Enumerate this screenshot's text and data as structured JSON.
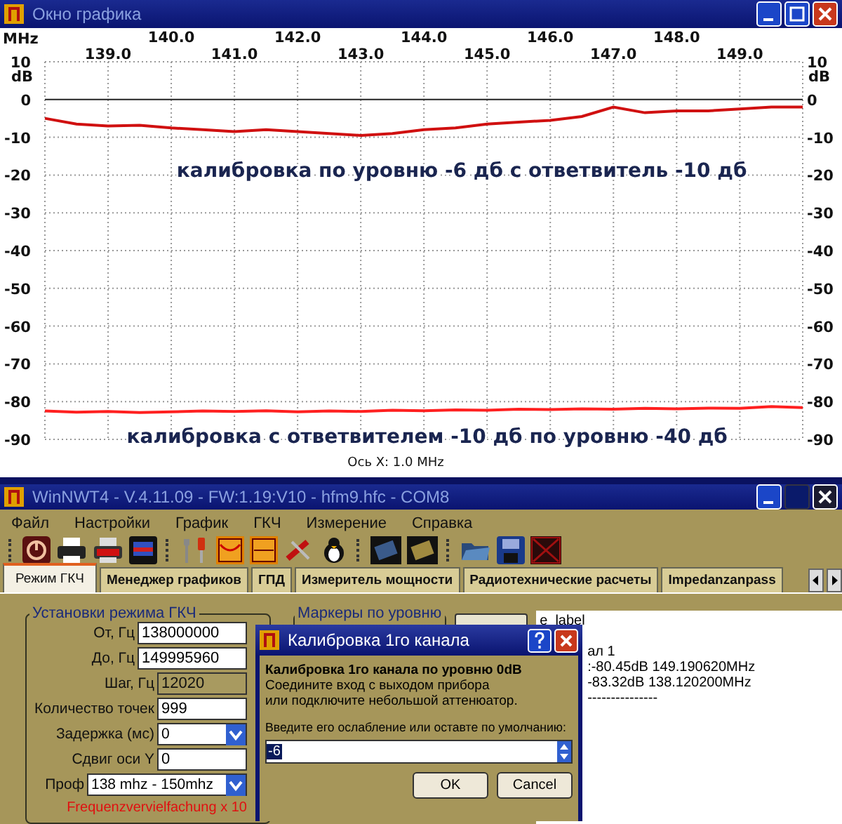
{
  "chart_window": {
    "title": "Окно графика",
    "x_unit": "MHz",
    "upper_axis_labels": [
      "140.0",
      "142.0",
      "144.0",
      "146.0",
      "148.0"
    ],
    "right_axis_unit": "dB",
    "right_axis_labels": [
      "10",
      "0",
      "-10",
      "-20",
      "-30",
      "-40",
      "-50",
      "-60",
      "-70",
      "-80",
      "-90"
    ],
    "chart_data": {
      "type": "line",
      "xlabel": "Ось X: 1.0 MHz",
      "ylabel": "dB",
      "xlim": [
        138,
        149.996
      ],
      "ylim": [
        -90,
        10
      ],
      "grid": true,
      "x": [
        138,
        138.5,
        139,
        139.5,
        140,
        140.5,
        141,
        141.5,
        142,
        142.5,
        143,
        143.5,
        144,
        144.5,
        145,
        145.5,
        146,
        146.5,
        147,
        147.5,
        148,
        148.5,
        149,
        149.5,
        149.996
      ],
      "series": [
        {
          "color": "#d01010",
          "values": [
            -5,
            -6.5,
            -7,
            -6.8,
            -7.5,
            -8,
            -8.5,
            -8,
            -8.5,
            -9,
            -9.5,
            -9,
            -8,
            -7.5,
            -6.5,
            -6,
            -5.5,
            -4.5,
            -2,
            -3.5,
            -3,
            -3,
            -2.5,
            -2,
            -2
          ]
        },
        {
          "color": "#ff2020",
          "values": [
            -82.5,
            -82.8,
            -82.6,
            -82.9,
            -82.7,
            -82.5,
            -82.6,
            -82.4,
            -82.7,
            -82.5,
            -82.6,
            -82.3,
            -82.4,
            -82.2,
            -82.3,
            -82,
            -82.1,
            -81.9,
            -82,
            -81.8,
            -81.9,
            -81.7,
            -81.8,
            -81.3,
            -81.6
          ]
        }
      ],
      "xticks": [
        {
          "value": 139,
          "label": "139.0"
        },
        {
          "value": 141,
          "label": "141.0"
        },
        {
          "value": 143,
          "label": "143.0"
        },
        {
          "value": 145,
          "label": "145.0"
        },
        {
          "value": 147,
          "label": "147.0"
        },
        {
          "value": 149,
          "label": "149.0"
        }
      ],
      "yticks": [
        10,
        0,
        -10,
        -20,
        -30,
        -40,
        -50,
        -60,
        -70,
        -80,
        -90
      ],
      "annotations": [
        "калибровка по уровню -6 дб с ответвитель -10 дб",
        "калибровка с ответвителем -10 дб по уровню -40 дб"
      ]
    }
  },
  "main_window": {
    "title": "WinNWT4 - V.4.11.09 - FW:1.19:V10 - hfm9.hfc - COM8",
    "maximize_disabled": true,
    "menu": [
      "Файл",
      "Настройки",
      "График",
      "ГКЧ",
      "Измерение",
      "Справка"
    ],
    "tabs": [
      {
        "label": "Режим ГКЧ",
        "selected": true
      },
      {
        "label": "Менеджер графиков",
        "selected": false
      },
      {
        "label": "ГПД",
        "selected": false
      },
      {
        "label": "Измеритель мощности",
        "selected": false
      },
      {
        "label": "Радиотехнические расчеты",
        "selected": false
      },
      {
        "label": "Impedanzanpass",
        "selected": false
      }
    ],
    "sweep_settings": {
      "title": "Установки режима ГКЧ",
      "fields": [
        {
          "kind": "input",
          "label": "От, Гц",
          "value": "138000000",
          "disabled": false
        },
        {
          "kind": "input",
          "label": "До, Гц",
          "value": "149995960",
          "disabled": false
        },
        {
          "kind": "input",
          "label": "Шаг, Гц",
          "value": "12020",
          "disabled": true
        },
        {
          "kind": "input",
          "label": "Количество точек",
          "value": "999",
          "disabled": false
        },
        {
          "kind": "dropdown",
          "label": "Задержка (мс)",
          "value": "0",
          "disabled": false
        },
        {
          "kind": "input",
          "label": "Сдвиг оси Y",
          "value": "0",
          "disabled": false
        },
        {
          "kind": "dropdown",
          "label": "Проф",
          "value": "138 mhz - 150mhz",
          "disabled": false
        }
      ],
      "note": "Frequenzvervielfachung x 10"
    },
    "markers": {
      "title": "Маркеры по уровню"
    },
    "log_lines": [
      "e_label",
      "ал 1",
      ":-80.45dB 149.190620MHz",
      "-83.32dB 138.120200MHz",
      "---------------"
    ]
  },
  "dialog": {
    "title": "Калибровка 1го канала",
    "heading": "Калибровка 1го канала по уровню 0dB",
    "lines": [
      "Соедините вход с выходом прибора",
      "или подключите небольшой аттенюатор."
    ],
    "prompt": "Введите его ослабление или оставте по умолчанию:",
    "value": "-6",
    "buttons": [
      "OK",
      "Cancel"
    ]
  }
}
